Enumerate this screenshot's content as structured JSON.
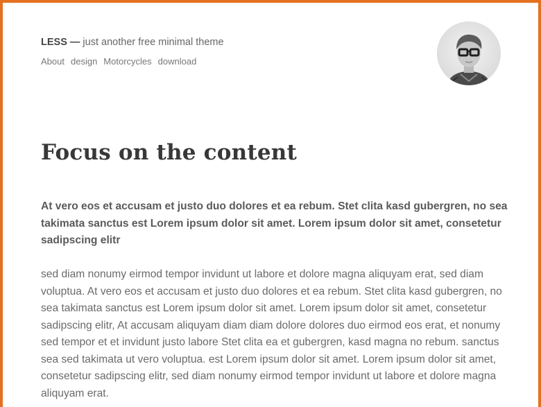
{
  "header": {
    "brand": "LESS —",
    "tagline": " just another free minimal theme",
    "nav": [
      "About",
      "design",
      "Motorcycles",
      "download"
    ]
  },
  "avatar": {
    "icon": "avatar-photo",
    "alt": "Author portrait"
  },
  "post": {
    "title": "Focus on the content",
    "lead": "At vero eos et accusam et justo duo dolores et ea rebum. Stet clita kasd gubergren, no sea takimata sanctus est Lorem ipsum dolor sit amet. Lorem ipsum dolor sit amet, consetetur sadipscing elitr",
    "body": "sed diam nonumy eirmod tempor invidunt ut labore et dolore magna aliquyam erat, sed diam voluptua. At vero eos et accusam et justo duo dolores et ea rebum. Stet clita kasd gubergren, no sea takimata sanctus est Lorem ipsum dolor sit amet. Lorem ipsum dolor sit amet, consetetur sadipscing elitr, At accusam aliquyam diam diam dolore dolores duo eirmod eos erat, et nonumy sed tempor et et invidunt justo labore Stet clita ea et gubergren, kasd magna no rebum. sanctus sea sed takimata ut vero voluptua. est Lorem ipsum dolor sit amet. Lorem ipsum dolor sit amet, consetetur sadipscing elitr, sed diam nonumy eirmod tempor invidunt ut labore et dolore magna aliquyam erat."
  },
  "colors": {
    "frame": "#e4711f",
    "text": "#6a6a6a",
    "heading": "#383838"
  }
}
